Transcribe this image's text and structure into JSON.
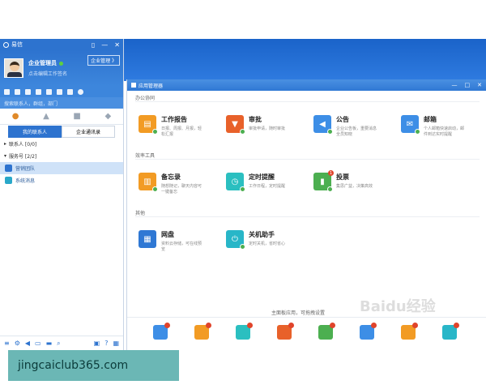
{
  "panel": {
    "title": "易信",
    "user": {
      "name": "企业管理员",
      "signature": "点击编辑工作签名"
    },
    "enterprise_btn": "企业管理 》",
    "search_placeholder": "搜索联系人，群组，部门",
    "sub_tabs": [
      "我的联系人",
      "企业通讯录"
    ],
    "groups": [
      {
        "label": "联系人 [0/0]",
        "expanded": false
      },
      {
        "label": "服务号 [2/2]",
        "expanded": true
      }
    ],
    "items": [
      "营销团队",
      "系统消息"
    ]
  },
  "app_manager": {
    "title": "应用管理器",
    "sections": [
      {
        "title": "办公协同",
        "apps": [
          {
            "name": "工作报告",
            "desc": "日报、周报、月报，轻松汇报",
            "color": "#f29b24"
          },
          {
            "name": "审批",
            "desc": "审批申请，随时审批",
            "color": "#e8612a"
          },
          {
            "name": "公告",
            "desc": "企业公告板，重要消息全员知晓",
            "color": "#3d8ee6"
          },
          {
            "name": "邮箱",
            "desc": "个人邮箱快速启动，邮件到达实时提醒",
            "color": "#3d8ee6"
          }
        ]
      },
      {
        "title": "效率工具",
        "apps": [
          {
            "name": "备忘录",
            "desc": "随想随记，聊天内容可一键备忘",
            "color": "#f29b24"
          },
          {
            "name": "定时提醒",
            "desc": "工作日程，定时提醒",
            "color": "#2bbfc0"
          },
          {
            "name": "投票",
            "desc": "集思广益，决策高效",
            "color": "#4caf50",
            "badge": "1"
          }
        ]
      },
      {
        "title": "其他",
        "apps": [
          {
            "name": "网盘",
            "desc": "资料云存储，可在线预览",
            "color": "#2f78d4"
          },
          {
            "name": "关机助手",
            "desc": "定时关机，省时省心",
            "color": "#28b6c8"
          }
        ]
      }
    ],
    "hint": "主面板应用，可拖拽设置",
    "dock_colors": [
      "#3d8ee6",
      "#f29b24",
      "#2bbfc0",
      "#e8612a",
      "#4caf50",
      "#3d8ee6",
      "#f29b24",
      "#28b6c8"
    ]
  },
  "watermark": "Baidu经验",
  "banner": {
    "text": "jingcaiclub365.com"
  }
}
